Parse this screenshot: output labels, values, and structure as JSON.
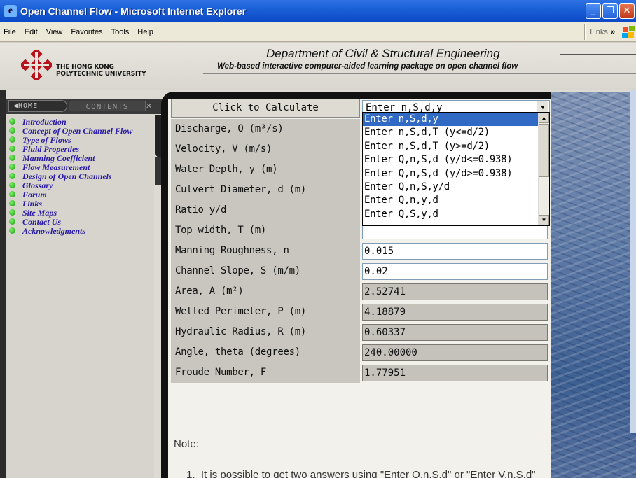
{
  "window": {
    "title": "Open Channel Flow - Microsoft Internet Explorer",
    "buttons": {
      "minimize": "_",
      "maximize": "❐",
      "close": "✕"
    }
  },
  "menubar": {
    "items": [
      "File",
      "Edit",
      "View",
      "Favorites",
      "Tools",
      "Help"
    ],
    "links": "Links",
    "chevron": "»"
  },
  "header": {
    "university": [
      "THE HONG KONG",
      "POLYTECHNIC UNIVERSITY"
    ],
    "department": "Department of Civil & Structural Engineering",
    "subtitle": "Web-based interactive computer-aided learning package on open channel flow"
  },
  "nav": {
    "home": "◀HOME",
    "contents": "CONTENTS",
    "close": "✕",
    "items": [
      "Introduction",
      "Concept of Open Channel Flow",
      "Type of Flows",
      "Fluid Properties",
      "Manning Coefficient",
      "Flow Measurement",
      "Design of Open Channels",
      "Glossary",
      "Forum",
      "Links",
      "Site Maps",
      "Contact Us",
      "Acknowledgments"
    ]
  },
  "calculator": {
    "button": "Click to Calculate",
    "mode_selected": "Enter n,S,d,y",
    "mode_options": [
      "Enter n,S,d,y",
      "Enter n,S,d,T (y<=d/2)",
      "Enter n,S,d,T (y>=d/2)",
      "Enter Q,n,S,d (y/d<=0.938)",
      "Enter Q,n,S,d (y/d>=0.938)",
      "Enter Q,n,S,y/d",
      "Enter Q,n,y,d",
      "Enter Q,S,y,d"
    ],
    "rows": [
      {
        "label": "Discharge, Q (m³/s)",
        "value": ""
      },
      {
        "label": "Velocity, V (m/s)",
        "value": ""
      },
      {
        "label": "Water Depth, y (m)",
        "value": ""
      },
      {
        "label": "Culvert Diameter, d (m)",
        "value": ""
      },
      {
        "label": "Ratio y/d",
        "value": ""
      },
      {
        "label": "Top width, T (m)",
        "value": ""
      },
      {
        "label": "Manning Roughness, n",
        "value": "0.015"
      },
      {
        "label": "Channel Slope, S (m/m)",
        "value": "0.02"
      },
      {
        "label": "Area, A (m²)",
        "value": "2.52741"
      },
      {
        "label": "Wetted Perimeter, P (m)",
        "value": "4.18879"
      },
      {
        "label": "Hydraulic Radius, R (m)",
        "value": "0.60337"
      },
      {
        "label": "Angle, theta (degrees)",
        "value": "240.00000"
      },
      {
        "label": "Froude Number, F",
        "value": "1.77951"
      }
    ]
  },
  "note": {
    "heading": "Note:",
    "items": [
      "It is possible to get two answers using \"Enter Q,n,S,d\" or \"Enter V,n,S,d\""
    ]
  }
}
